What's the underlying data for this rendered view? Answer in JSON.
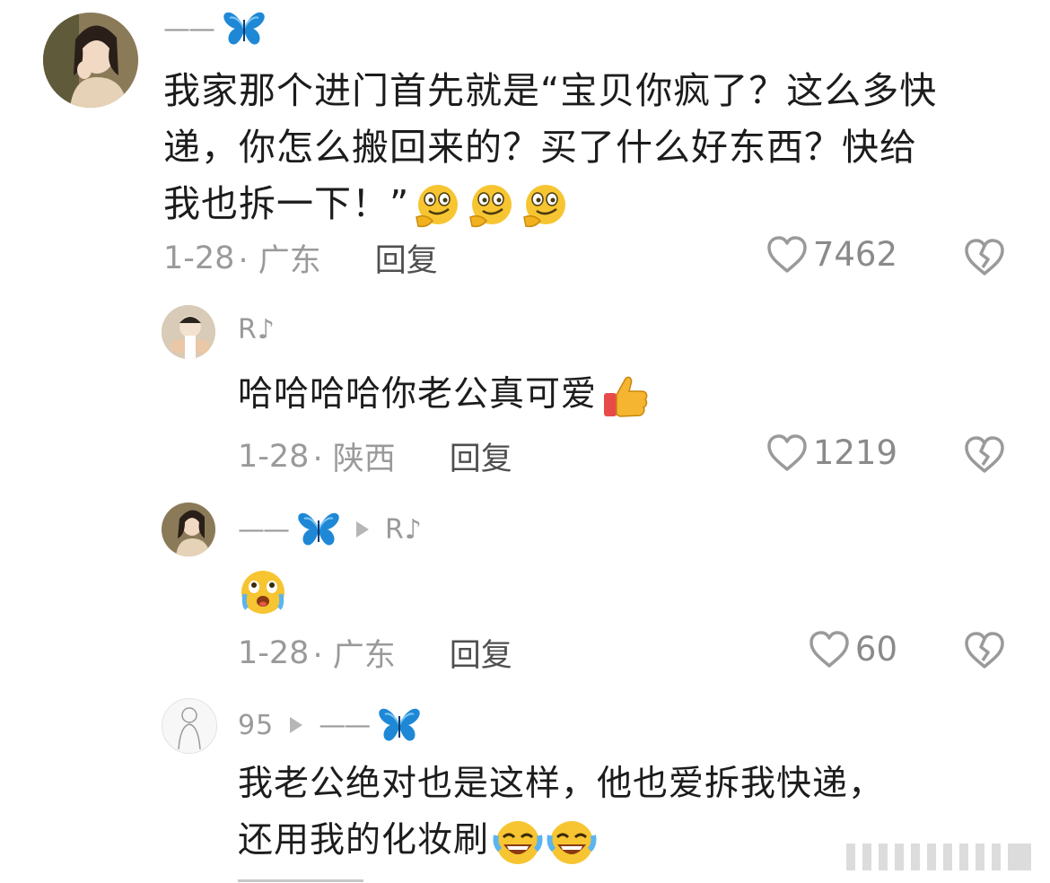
{
  "comments": [
    {
      "author_dash": "——",
      "text": "我家那个进门首先就是“宝贝你疯了？这么多快递，你怎么搬回来的？买了什么好东西？快给我也拆一下！”",
      "line1": "我家那个进门首先就是“宝贝你疯了？这么多快",
      "line2": "递，你怎么搬回来的？买了什么好东西？快给",
      "line3": "我也拆一下！”",
      "date": "1-28",
      "region": "· 广东",
      "reply_label": "回复",
      "likes": "7462"
    },
    {
      "author": "R♪",
      "text": "哈哈哈哈你老公真可爱",
      "date": "1-28",
      "region": "· 陕西",
      "reply_label": "回复",
      "likes": "1219"
    },
    {
      "author_dash": "——",
      "reply_to": "R♪",
      "date": "1-28",
      "region": "· 广东",
      "reply_label": "回复",
      "likes": "60"
    },
    {
      "author": "95",
      "reply_to_dash": "——",
      "line1": "我老公绝对也是这样，他也爱拆我快递，",
      "line2": "还用我的化妆刷"
    }
  ],
  "colors": {
    "butterfly": "#1e88d6",
    "meta_gray": "#9a9a9a",
    "text": "#1c1c1c"
  },
  "icons": [
    "butterfly-icon",
    "heart-icon",
    "broken-heart-icon",
    "reply-arrow-icon",
    "emoji-thinking",
    "emoji-thumbs-up",
    "emoji-crying-face",
    "emoji-laughing-tears"
  ]
}
